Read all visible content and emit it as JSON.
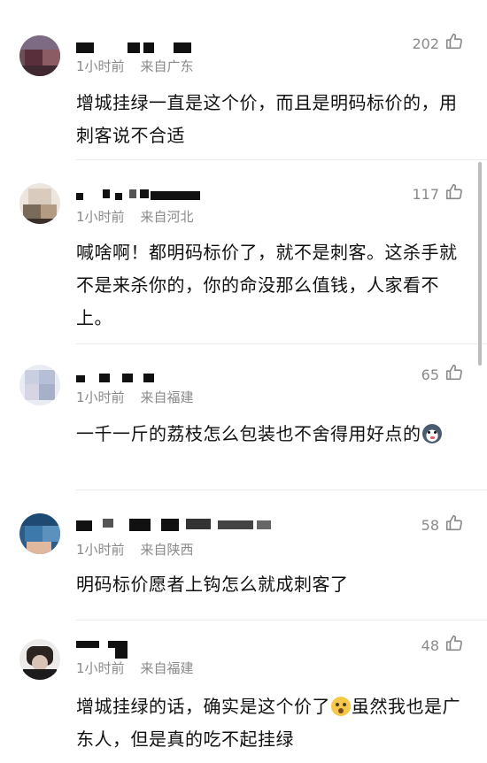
{
  "comments": [
    {
      "username": "■ ■■ ■",
      "time": "1小时前",
      "location": "来自广东",
      "likes": "202",
      "text": "增城挂绿一直是这个价，而且是明码标价的，用刺客说不合适",
      "avatar_icon": "user-avatar-icon"
    },
    {
      "username": "■ ■ ■■■■",
      "time": "1小时前",
      "location": "来自河北",
      "likes": "117",
      "text": "喊啥啊！都明码标价了，就不是刺客。这杀手就不是来杀你的，你的命没那么值钱，人家看不上。",
      "avatar_icon": "user-avatar-icon"
    },
    {
      "username": "■ ■ ■ ■",
      "time": "1小时前",
      "location": "来自福建",
      "likes": "65",
      "text": "一千一斤的荔枝怎么包装也不舍得用好点的",
      "emoji": "husky-emoji-icon",
      "avatar_icon": "user-avatar-icon"
    },
    {
      "username": "■ ■■ ■■■■■",
      "time": "1小时前",
      "location": "来自陕西",
      "likes": "58",
      "text": "明码标价愿者上钩怎么就成刺客了",
      "avatar_icon": "user-avatar-icon"
    },
    {
      "username": "■■ ■",
      "time": "1小时前",
      "location": "来自福建",
      "likes": "48",
      "text_before_emoji": "增城挂绿的话，确实是这个价了",
      "emoji": "shocked-face-emoji-icon",
      "text_after_emoji": "虽然我也是广东人，但是真的吃不起挂绿",
      "avatar_icon": "user-avatar-icon"
    }
  ],
  "colors": {
    "text": "#111111",
    "meta": "#8a8a8a",
    "divider": "#ececec"
  }
}
